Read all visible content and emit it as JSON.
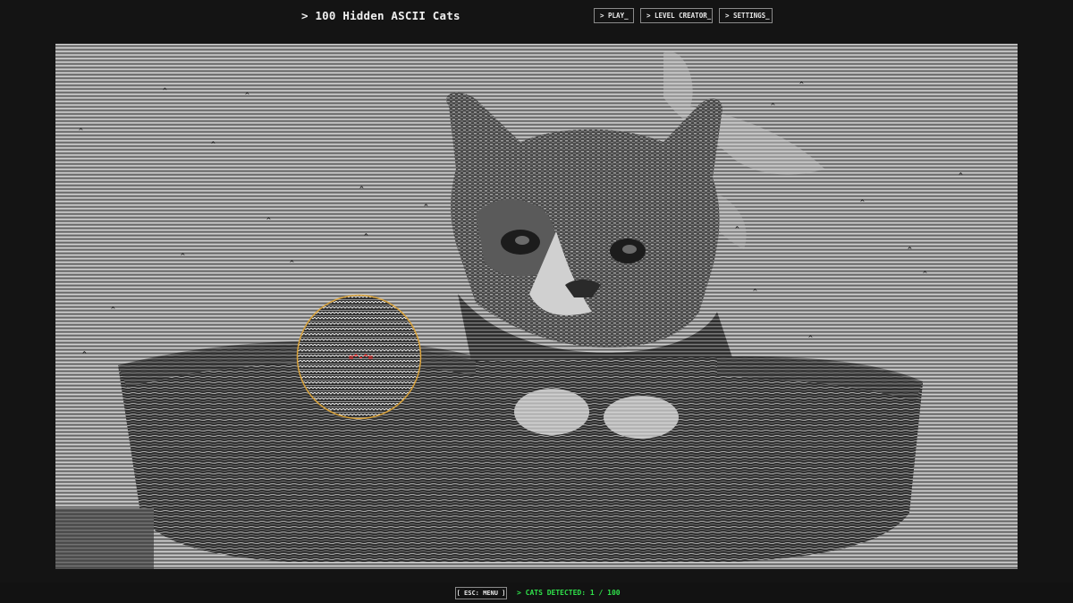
{
  "header": {
    "title": "> 100 Hidden ASCII Cats",
    "nav": {
      "play": "> PLAY_",
      "level_creator": "> LEVEL CREATOR_",
      "settings": "> SETTINGS_"
    }
  },
  "game": {
    "scene": "ascii-art-kitten-in-basket",
    "hidden_cat_glyph": "^",
    "magnifier_color": "#d9a23a",
    "found_cat_color": "#ff2020"
  },
  "footer": {
    "menu_label": "[ ESC: MENU ]",
    "status_text": "> CATS DETECTED: 1 / 100",
    "status_color": "#2fe04a"
  }
}
